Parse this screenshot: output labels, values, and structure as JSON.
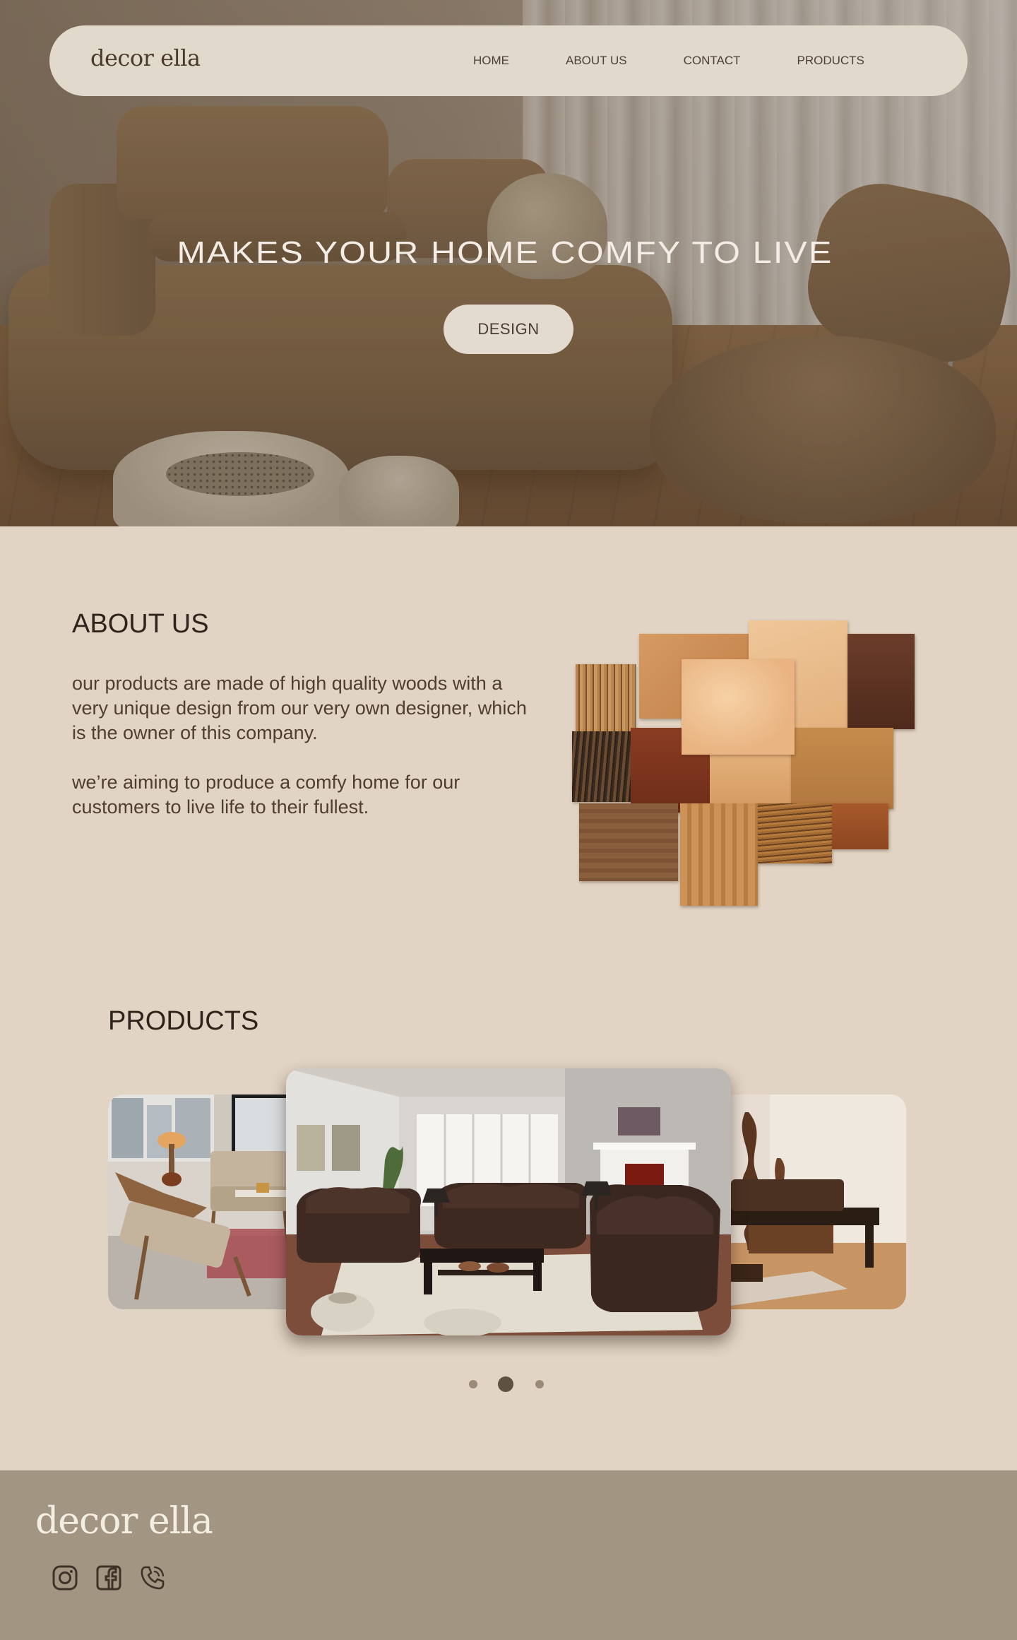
{
  "brand": {
    "logo_text": "decor ella"
  },
  "nav": {
    "items": [
      {
        "label": "HOME"
      },
      {
        "label": "ABOUT US"
      },
      {
        "label": "CONTACT"
      },
      {
        "label": "PRODUCTS"
      }
    ]
  },
  "hero": {
    "title": "MAKES YOUR HOME COMFY TO LIVE",
    "button_label": "DESIGN"
  },
  "about": {
    "title": "ABOUT US",
    "paragraph_1": "our products are made of high quality woods with a very unique design from our very own designer, which is the owner of this company.",
    "paragraph_2": "we’re aiming to produce a comfy home for our customers to live life to their fullest."
  },
  "products": {
    "title": "PRODUCTS",
    "carousel": {
      "total_slides": 3,
      "active_index": 1
    }
  },
  "footer": {
    "logo_text": "decor ella",
    "social_icons": [
      "instagram-icon",
      "facebook-icon",
      "phone-icon"
    ]
  },
  "colors": {
    "page_bg": "#e1d4c4",
    "nav_bg": "#e2d9cd",
    "footer_bg": "#a29582",
    "text_dark": "#2e241b",
    "dot_inactive": "#9a8b79",
    "dot_active": "#5f5141"
  }
}
